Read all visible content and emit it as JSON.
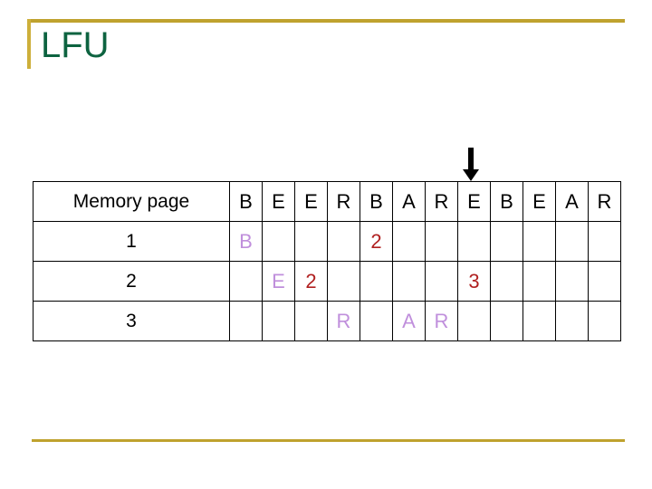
{
  "slide": {
    "title": "LFU"
  },
  "annotation": {
    "arrow_icon": "arrow-down-icon",
    "points_to_column_index": 7
  },
  "colors": {
    "title_text": "#0d6340",
    "rule_gold": "#bfa22e",
    "letter_purple": "#c08fdc",
    "count_red": "#b02020",
    "grid_black": "#000000",
    "background": "#ffffff"
  },
  "table": {
    "label_header": "Memory page",
    "reference_string": [
      "B",
      "E",
      "E",
      "R",
      "B",
      "A",
      "R",
      "E",
      "B",
      "E",
      "A",
      "R"
    ],
    "rows": [
      {
        "label": "1",
        "cells": [
          {
            "text": "B",
            "kind": "letter"
          },
          {
            "text": "",
            "kind": "empty"
          },
          {
            "text": "",
            "kind": "empty"
          },
          {
            "text": "",
            "kind": "empty"
          },
          {
            "text": "2",
            "kind": "count"
          },
          {
            "text": "",
            "kind": "empty"
          },
          {
            "text": "",
            "kind": "empty"
          },
          {
            "text": "",
            "kind": "empty"
          },
          {
            "text": "",
            "kind": "empty"
          },
          {
            "text": "",
            "kind": "empty"
          },
          {
            "text": "",
            "kind": "empty"
          },
          {
            "text": "",
            "kind": "empty"
          }
        ]
      },
      {
        "label": "2",
        "cells": [
          {
            "text": "",
            "kind": "empty"
          },
          {
            "text": "E",
            "kind": "letter"
          },
          {
            "text": "2",
            "kind": "count"
          },
          {
            "text": "",
            "kind": "empty"
          },
          {
            "text": "",
            "kind": "empty"
          },
          {
            "text": "",
            "kind": "empty"
          },
          {
            "text": "",
            "kind": "empty"
          },
          {
            "text": "3",
            "kind": "count"
          },
          {
            "text": "",
            "kind": "empty"
          },
          {
            "text": "",
            "kind": "empty"
          },
          {
            "text": "",
            "kind": "empty"
          },
          {
            "text": "",
            "kind": "empty"
          }
        ]
      },
      {
        "label": "3",
        "cells": [
          {
            "text": "",
            "kind": "empty"
          },
          {
            "text": "",
            "kind": "empty"
          },
          {
            "text": "",
            "kind": "empty"
          },
          {
            "text": "R",
            "kind": "letter"
          },
          {
            "text": "",
            "kind": "empty"
          },
          {
            "text": "A",
            "kind": "letter"
          },
          {
            "text": "R",
            "kind": "letter"
          },
          {
            "text": "",
            "kind": "empty"
          },
          {
            "text": "",
            "kind": "empty"
          },
          {
            "text": "",
            "kind": "empty"
          },
          {
            "text": "",
            "kind": "empty"
          },
          {
            "text": "",
            "kind": "empty"
          }
        ]
      }
    ]
  }
}
